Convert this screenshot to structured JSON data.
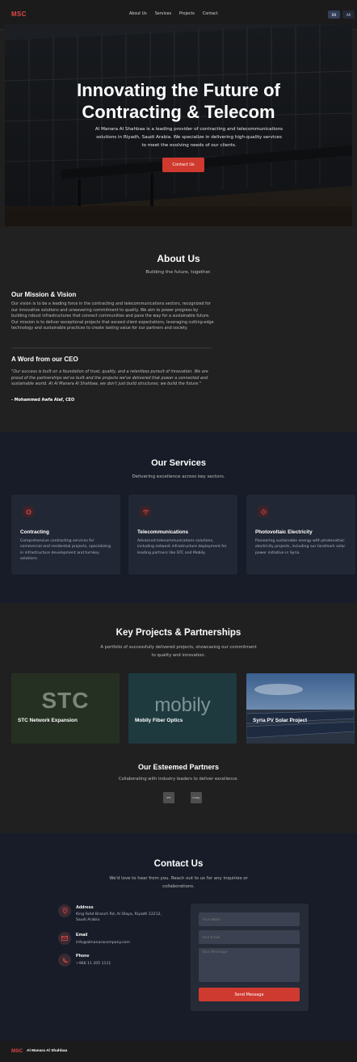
{
  "nav": {
    "logo": "MSC",
    "links": [
      "About Us",
      "Services",
      "Projects",
      "Contact"
    ],
    "lang": [
      "EN",
      "AR"
    ]
  },
  "hero": {
    "title_line1": "Innovating the Future of",
    "title_line2": "Contracting & Telecom",
    "description": "Al Manara Al Shahbaa is a leading provider of contracting and telecommunications solutions in Riyadh, Saudi Arabia. We specialize in delivering high-quality services to meet the evolving needs of our clients.",
    "cta": "Contact Us"
  },
  "about": {
    "title": "About Us",
    "subtitle": "Building the future, together.",
    "mission_title": "Our Mission & Vision",
    "mission_text": "Our vision is to be a leading force in the contracting and telecommunications sectors, recognized for our innovative solutions and unwavering commitment to quality. We aim to power progress by building robust infrastructures that connect communities and pave the way for a sustainable future. Our mission is to deliver exceptional projects that exceed client expectations, leveraging cutting-edge technology and sustainable practices to create lasting value for our partners and society.",
    "ceo_title": "A Word from our CEO",
    "ceo_quote": "\"Our success is built on a foundation of trust, quality, and a relentless pursuit of innovation. We are proud of the partnerships we've built and the projects we've delivered that power a connected and sustainable world. At Al Manara Al Shahbaa, we don't just build structures; we build the future.\"",
    "ceo_sign": "- Mohammed Awfa Alaf, CEO"
  },
  "services": {
    "title": "Our Services",
    "subtitle": "Delivering excellence across key sectors.",
    "items": [
      {
        "title": "Contracting",
        "icon": "gear-icon",
        "desc": "Comprehensive contracting services for commercial and residential projects, specializing in infrastructure development and turnkey solutions."
      },
      {
        "title": "Telecommunications",
        "icon": "wifi-icon",
        "desc": "Advanced telecommunications solutions, including network infrastructure deployment for leading partners like STC and Mobily."
      },
      {
        "title": "Photovoltaic Electricity",
        "icon": "sun-icon",
        "desc": "Pioneering sustainable energy with photovoltaic electricity projects, including our landmark solar power initiative in Syria."
      }
    ]
  },
  "projects": {
    "title": "Key Projects & Partnerships",
    "subtitle_line1": "A portfolio of successfully delivered projects, showcasing our commitment",
    "subtitle_line2": "to quality and innovation.",
    "items": [
      {
        "title": "STC Network Expansion",
        "logo": "STC"
      },
      {
        "title": "Mobily Fiber Optics",
        "logo": "mobily"
      },
      {
        "title": "Syria PV Solar Project",
        "logo": ""
      }
    ],
    "partners_title": "Our Esteemed Partners",
    "partners_subtitle": "Collaborating with industry leaders to deliver excellence.",
    "partner_logos": [
      "STC",
      "mobily"
    ]
  },
  "contact": {
    "title": "Contact Us",
    "subtitle_line1": "We'd love to hear from you. Reach out to us for any inquiries or",
    "subtitle_line2": "collaborations.",
    "address_label": "Address",
    "address_line1": "King Fahd Branch Rd, Al Olaya, Riyadh 12212,",
    "address_line2": "Saudi Arabia",
    "email_label": "Email",
    "email_value": "info@almanaracompany.com",
    "phone_label": "Phone",
    "phone_value": "+966 11 205 1111",
    "form": {
      "name_placeholder": "Your Name",
      "email_placeholder": "Your Email",
      "message_placeholder": "Your Message",
      "send_label": "Send Message"
    }
  },
  "footer": {
    "logo": "MSC",
    "name": "Al Manara Al Shahbaa"
  },
  "colors": {
    "accent": "#d0392e",
    "dark_bg": "#1f1f1f",
    "navy_bg": "#171c28"
  }
}
